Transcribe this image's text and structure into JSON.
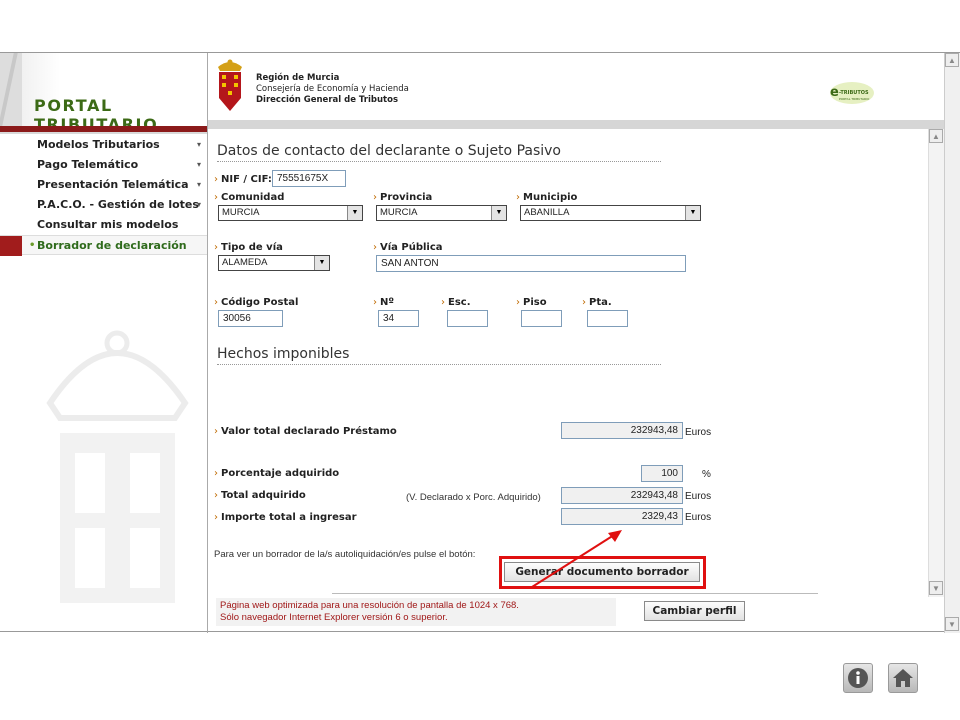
{
  "header": {
    "portal_title": "PORTAL TRIBUTARIO",
    "org_line1": "Región de Murcia",
    "org_line2": "Consejería de Economía y Hacienda",
    "org_line3": "Dirección General de Tributos",
    "etributos_logo": "e-TRIBUTOS",
    "etributos_sub": "PORTAL TRIBUTARIO"
  },
  "menu": {
    "items": [
      {
        "label": "Modelos Tributarios",
        "expandable": true
      },
      {
        "label": "Pago Telemático",
        "expandable": true
      },
      {
        "label": "Presentación Telemática",
        "expandable": true
      },
      {
        "label": "P.A.C.O. - Gestión de lotes",
        "expandable": true
      },
      {
        "label": "Consultar mis modelos",
        "expandable": false
      },
      {
        "label": "Borrador de declaración",
        "expandable": false,
        "active": true
      }
    ]
  },
  "contact": {
    "title": "Datos de contacto del declarante o Sujeto Pasivo",
    "nif_label": "NIF / CIF:",
    "nif_value": "75551675X",
    "comunidad_label": "Comunidad",
    "comunidad_value": "MURCIA",
    "provincia_label": "Provincia",
    "provincia_value": "MURCIA",
    "municipio_label": "Municipio",
    "municipio_value": "ABANILLA",
    "tipo_via_label": "Tipo de vía",
    "tipo_via_value": "ALAMEDA",
    "via_publica_label": "Vía Pública",
    "via_publica_value": "SAN ANTON",
    "cp_label": "Código Postal",
    "cp_value": "30056",
    "num_label": "Nº",
    "num_value": "34",
    "esc_label": "Esc.",
    "esc_value": "",
    "piso_label": "Piso",
    "piso_value": "",
    "pta_label": "Pta.",
    "pta_value": ""
  },
  "hechos": {
    "title": "Hechos imponibles",
    "valor_label": "Valor total declarado Préstamo",
    "valor_value": "232943,48",
    "porcentaje_label": "Porcentaje adquirido",
    "porcentaje_value": "100",
    "porcentaje_unit": "%",
    "total_label": "Total adquirido",
    "total_note": "(V. Declarado x Porc. Adquirido)",
    "total_value": "232943,48",
    "importe_label": "Importe total a ingresar",
    "importe_value": "2329,43",
    "currency": "Euros"
  },
  "actions": {
    "instruction": "Para ver un borrador de la/s autoliquidación/es pulse el botón:",
    "generate_label": "Generar documento borrador",
    "change_profile_label": "Cambiar perfil"
  },
  "footer": {
    "line1": "Página web optimizada para una resolución de pantalla de 1024 x 768.",
    "line2": "Sólo navegador Internet Explorer versión 6 o superior."
  },
  "colors": {
    "annotation_red": "#e01010",
    "brand_green": "#3c6a16",
    "brand_red": "#a11c1c"
  },
  "icons": {
    "info": "info-icon",
    "home": "home-icon"
  }
}
